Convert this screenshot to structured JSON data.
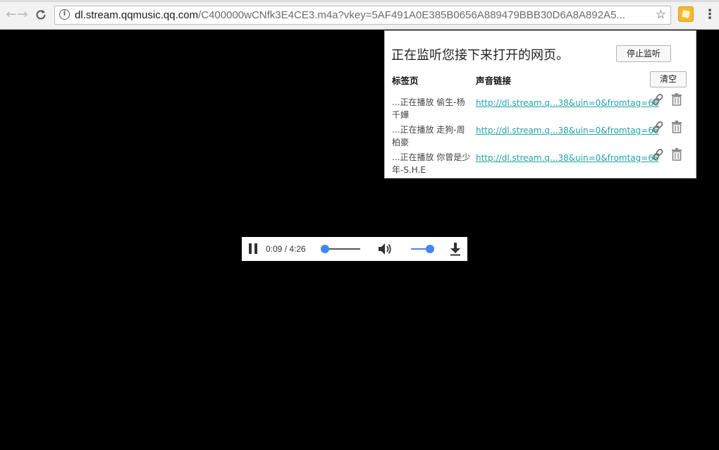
{
  "browser": {
    "url_host": "dl.stream.qqmusic.qq.com",
    "url_rest": "/C400000wCNfk3E4CE3.m4a?vkey=5AF491A0E385B0656A889479BBB30D6A8A892A5...",
    "info_glyph": "i",
    "icons": [
      "back-arrow-icon",
      "forward-arrow-icon",
      "reload-icon",
      "info-icon",
      "star-icon",
      "extension-icon",
      "menu-icon"
    ]
  },
  "popup": {
    "title": "正在监听您接下来打开的网页。",
    "stop_label": "停止监听",
    "clear_label": "清空",
    "col_tab": "标签页",
    "col_link": "声音链接",
    "rows": [
      {
        "tab": "...正在播放 偷生-杨千嬅",
        "link": "http://dl.stream.q...38&uin=0&fromtag=66"
      },
      {
        "tab": "...正在播放 走狗-周柏豪",
        "link": "http://dl.stream.q...38&uin=0&fromtag=66"
      },
      {
        "tab": "...正在播放 你曾是少年-S.H.E",
        "link": "http://dl.stream.q...38&uin=0&fromtag=66"
      }
    ],
    "link_color": "#1fa3a8"
  },
  "player": {
    "time": "0:09 / 4:26",
    "progress": 0.035,
    "volume": 1.0,
    "accent_color": "#4285f4",
    "icons": [
      "pause-icon",
      "volume-icon",
      "download-icon"
    ]
  }
}
